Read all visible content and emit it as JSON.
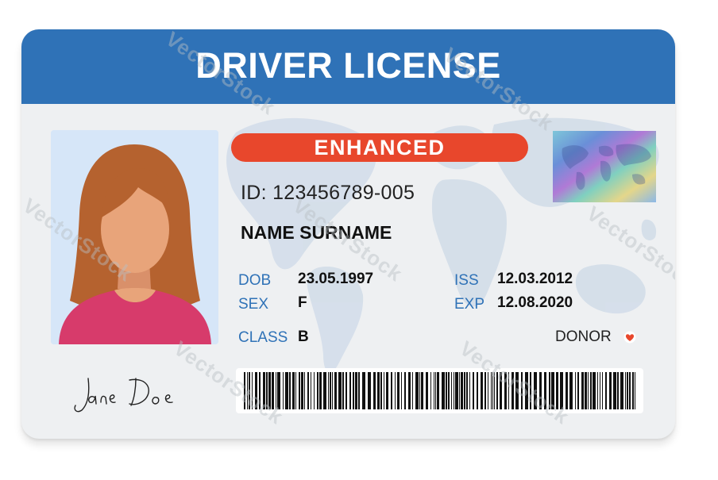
{
  "card": {
    "title": "DRIVER LICENSE",
    "badge": "ENHANCED",
    "id_line": "ID: 123456789-005",
    "name": "NAME SURNAME",
    "fields": {
      "dob_label": "DOB",
      "dob_value": "23.05.1997",
      "sex_label": "SEX",
      "sex_value": "F",
      "class_label": "CLASS",
      "class_value": "B",
      "iss_label": "ISS",
      "iss_value": "12.03.2012",
      "exp_label": "EXP",
      "exp_value": "12.08.2020"
    },
    "donor_label": "DONOR",
    "signature": "Jane Doe"
  },
  "watermark": "VectorStock",
  "colors": {
    "header": "#2f72b7",
    "badge": "#e8472c",
    "label": "#2f72b7",
    "hair": "#b5622f",
    "skin": "#e8a47a",
    "shirt": "#d73b6b",
    "photo_bg": "#d6e6f8"
  },
  "icons": [
    "heart-icon",
    "hologram",
    "barcode",
    "world-map"
  ]
}
